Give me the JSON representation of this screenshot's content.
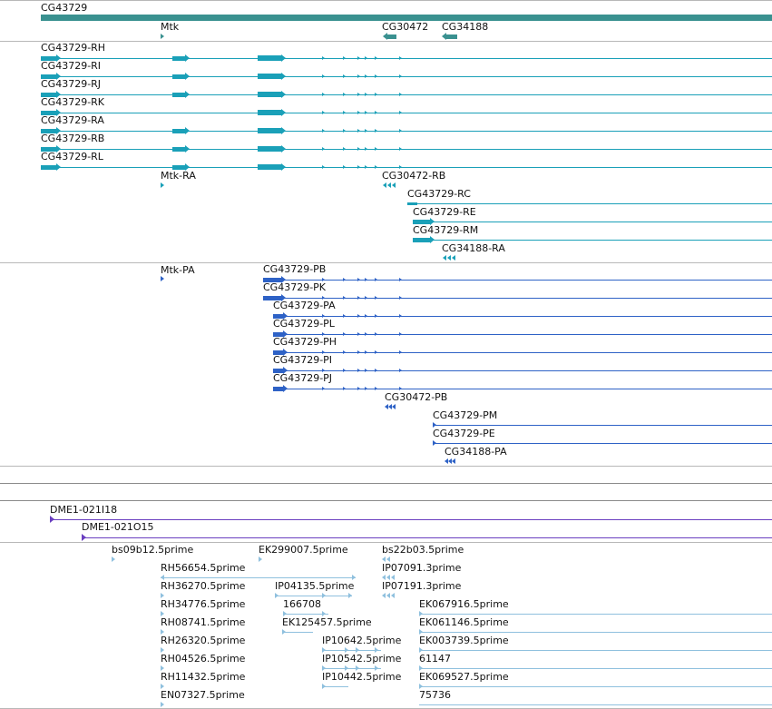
{
  "colors": {
    "gene": "#3a9190",
    "transcript": "#1aa0b8",
    "protein": "#2e62c6",
    "clone": "#6a3fc0",
    "est": "#8fc0de",
    "separator": "#b8b8b8"
  },
  "genes": [
    {
      "name": "CG43729"
    },
    {
      "name": "Mtk"
    },
    {
      "name": "CG30472"
    },
    {
      "name": "CG34188"
    }
  ],
  "transcripts": [
    {
      "name": "CG43729-RH"
    },
    {
      "name": "CG43729-RI"
    },
    {
      "name": "CG43729-RJ"
    },
    {
      "name": "CG43729-RK"
    },
    {
      "name": "CG43729-RA"
    },
    {
      "name": "CG43729-RB"
    },
    {
      "name": "CG43729-RL"
    },
    {
      "name": "Mtk-RA"
    },
    {
      "name": "CG30472-RB"
    },
    {
      "name": "CG43729-RC"
    },
    {
      "name": "CG43729-RE"
    },
    {
      "name": "CG43729-RM"
    },
    {
      "name": "CG34188-RA"
    }
  ],
  "proteins": [
    {
      "name": "Mtk-PA"
    },
    {
      "name": "CG43729-PB"
    },
    {
      "name": "CG43729-PK"
    },
    {
      "name": "CG43729-PA"
    },
    {
      "name": "CG43729-PL"
    },
    {
      "name": "CG43729-PH"
    },
    {
      "name": "CG43729-PI"
    },
    {
      "name": "CG43729-PJ"
    },
    {
      "name": "CG30472-PB"
    },
    {
      "name": "CG43729-PM"
    },
    {
      "name": "CG43729-PE"
    },
    {
      "name": "CG34188-PA"
    }
  ],
  "clones": [
    {
      "name": "DME1-021I18"
    },
    {
      "name": "DME1-021O15"
    }
  ],
  "ests": [
    {
      "name": "bs09b12.5prime"
    },
    {
      "name": "EK299007.5prime"
    },
    {
      "name": "bs22b03.5prime"
    },
    {
      "name": "RH56654.5prime"
    },
    {
      "name": "IP07091.3prime"
    },
    {
      "name": "RH36270.5prime"
    },
    {
      "name": "IP04135.5prime"
    },
    {
      "name": "IP07191.3prime"
    },
    {
      "name": "RH34776.5prime"
    },
    {
      "name": "166708"
    },
    {
      "name": "EK067916.5prime"
    },
    {
      "name": "RH08741.5prime"
    },
    {
      "name": "EK125457.5prime"
    },
    {
      "name": "EK061146.5prime"
    },
    {
      "name": "RH26320.5prime"
    },
    {
      "name": "IP10642.5prime"
    },
    {
      "name": "EK003739.5prime"
    },
    {
      "name": "RH04526.5prime"
    },
    {
      "name": "IP10542.5prime"
    },
    {
      "name": "61147"
    },
    {
      "name": "RH11432.5prime"
    },
    {
      "name": "IP10442.5prime"
    },
    {
      "name": "EK069527.5prime"
    },
    {
      "name": "EN07327.5prime"
    },
    {
      "name": "75736"
    }
  ]
}
